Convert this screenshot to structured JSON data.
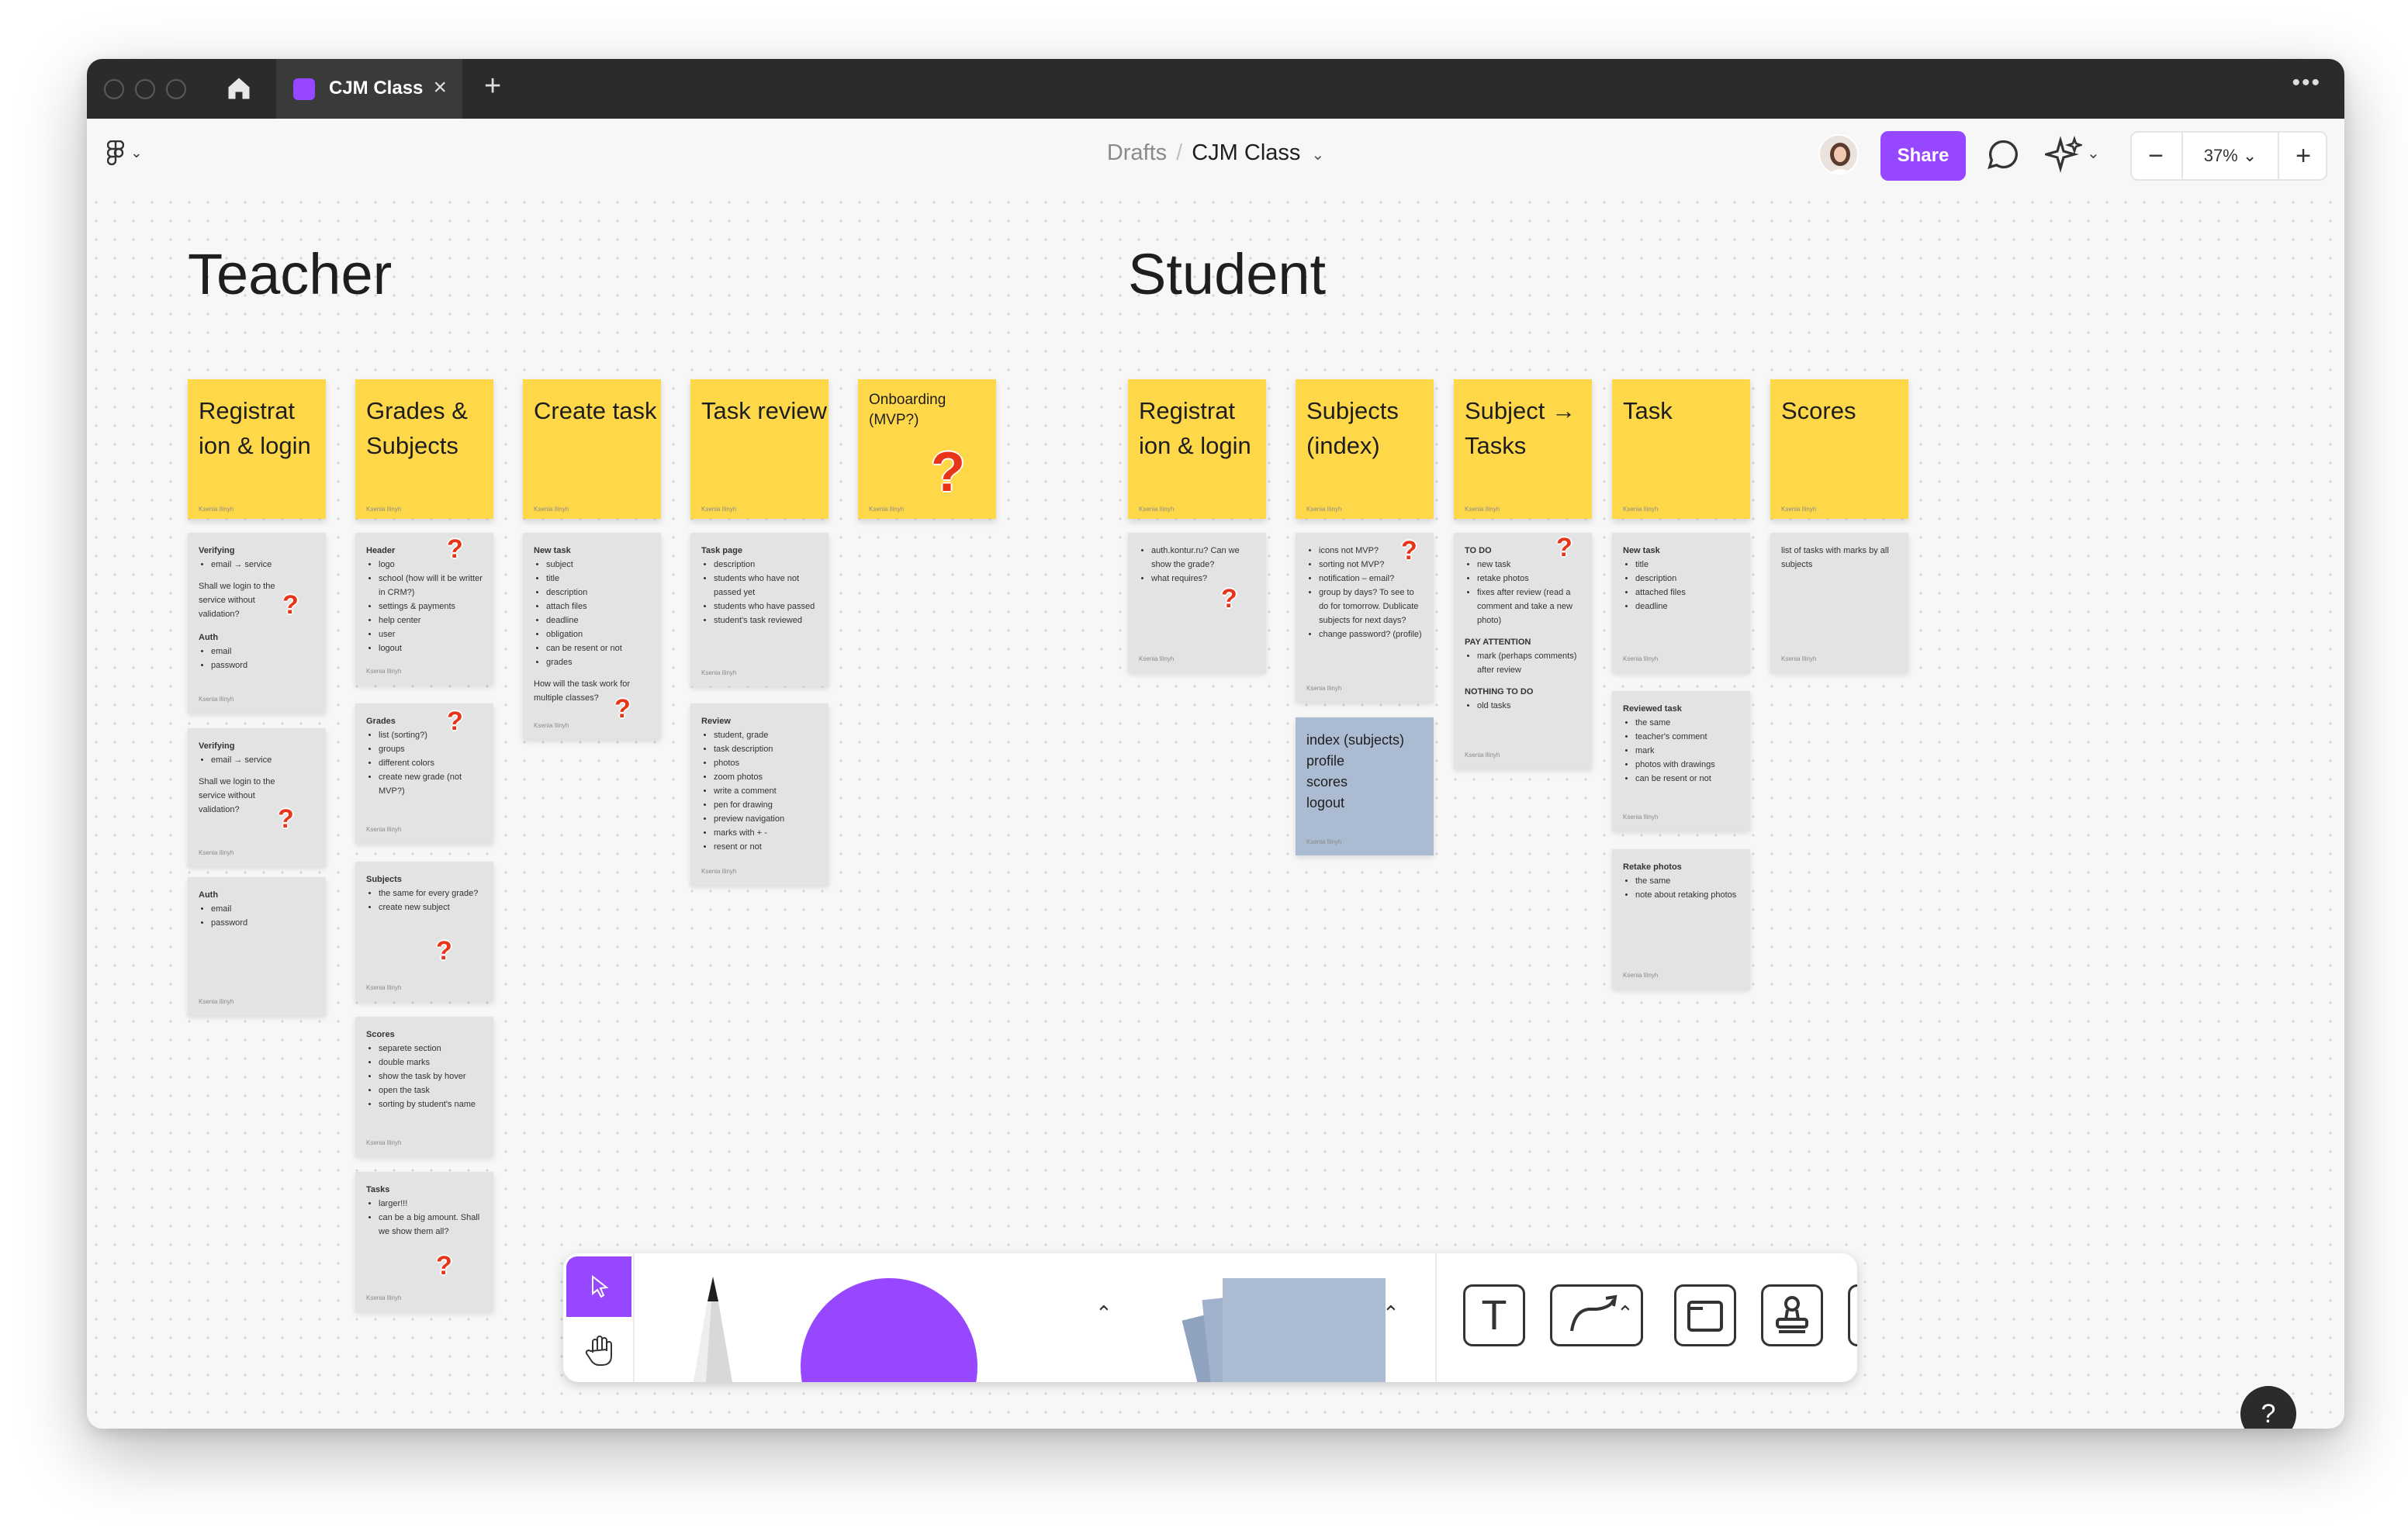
{
  "window": {
    "tab_title": "CJM Class"
  },
  "toolbar": {
    "breadcrumb_parent": "Drafts",
    "breadcrumb_sep": "/",
    "file_name": "CJM Class",
    "share_label": "Share",
    "zoom": "37%",
    "zoom_out": "−",
    "zoom_in": "+"
  },
  "board": {
    "teacher_title": "Teacher",
    "student_title": "Student",
    "author": "Ksenia Ilinyh",
    "question": "?",
    "teacher": {
      "headers": [
        "Registrat ion & login",
        "Grades & Subjects",
        "Create task",
        "Task review",
        "Onboarding (MVP?)"
      ],
      "reg1": {
        "h": "Verifying",
        "li": [
          "email → service"
        ],
        "p": "Shall we login to the service without validation?",
        "h2": "Auth",
        "li2": [
          "email",
          "password"
        ]
      },
      "reg2": {
        "h": "Verifying",
        "li": [
          "email → service"
        ],
        "p": "Shall we login to the service without validation?"
      },
      "reg3": {
        "h": "Auth",
        "li": [
          "email",
          "password"
        ]
      },
      "grades1": {
        "h": "Header",
        "li": [
          "logo",
          "school (how will it be writter in CRM?)",
          "settings & payments",
          "help center",
          "user",
          "logout"
        ]
      },
      "grades2": {
        "h": "Grades",
        "li": [
          "list (sorting?)",
          "groups",
          "different colors",
          "create new grade (not MVP?)"
        ]
      },
      "grades3": {
        "h": "Subjects",
        "li": [
          "the same for every grade?",
          "create new subject"
        ]
      },
      "grades4": {
        "h": "Scores",
        "li": [
          "separete section",
          "double marks",
          "show the task by hover",
          "open the task",
          "sorting by student's name"
        ]
      },
      "grades5": {
        "h": "Tasks",
        "li": [
          "larger!!!",
          "can be a big amount. Shall we show them all?"
        ]
      },
      "create1": {
        "h": "New task",
        "li": [
          "subject",
          "title",
          "description",
          "attach files",
          "deadline",
          "obligation",
          "can be resent or not",
          "grades"
        ],
        "p": "How will the task work for multiple classes?"
      },
      "review1": {
        "h": "Task page",
        "li": [
          "description",
          "students who have not passed yet",
          "students who have passed",
          "student's task reviewed"
        ]
      },
      "review2": {
        "h": "Review",
        "li": [
          "student, grade",
          "task description",
          "photos",
          "zoom photos",
          "write a comment",
          "pen for drawing",
          "preview navigation",
          "marks with + -",
          "resent or not"
        ]
      }
    },
    "student": {
      "headers": [
        "Registrat ion & login",
        "Subjects (index)",
        "Subject → Tasks",
        "Task",
        "Scores"
      ],
      "reg1": {
        "li": [
          "auth.kontur.ru? Can we show the grade?",
          "what requires?"
        ]
      },
      "subj1": {
        "li": [
          "icons not MVP?",
          "sorting not MVP?",
          "notification – email?",
          "group by days? To see to do for tomorrow. Dublicate subjects for next days?",
          "change password? (profile)"
        ]
      },
      "subj2": {
        "lines": [
          "index (subjects)",
          "profile",
          "scores",
          "logout"
        ]
      },
      "tasks1": {
        "h": "TO DO",
        "li": [
          "new task",
          "retake photos",
          "fixes after review (read a comment and take a new photo)"
        ],
        "h2": "PAY ATTENTION",
        "li2": [
          "mark (perhaps comments) after review"
        ],
        "h3": "NOTHING TO DO",
        "li3": [
          "old tasks"
        ]
      },
      "task1": {
        "h": "New task",
        "li": [
          "title",
          "description",
          "attached files",
          "deadline"
        ]
      },
      "task2": {
        "h": "Reviewed task",
        "li": [
          "the same",
          "teacher's comment",
          "mark",
          "photos with drawings",
          "can be resent or not"
        ]
      },
      "task3": {
        "h": "Retake photos",
        "li": [
          "the same",
          "note about retaking photos"
        ]
      },
      "scores1": {
        "p": "list of tasks with marks by all subjects"
      }
    }
  },
  "help_label": "?",
  "colors": {
    "accent": "#9747ff",
    "sticky_yellow": "#ffd84a",
    "note_gray": "#e3e3e3",
    "note_blue": "#abbcd2",
    "question_red": "#e8351a"
  }
}
